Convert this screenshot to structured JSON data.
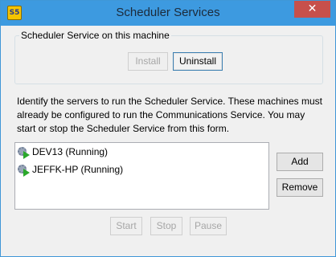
{
  "window": {
    "title": "Scheduler Services",
    "app_icon_text": "S5",
    "close_glyph": "✕"
  },
  "machine_group": {
    "label": "Scheduler Service on this machine",
    "install_label": "Install",
    "uninstall_label": "Uninstall"
  },
  "description": "Identify the servers to run the Scheduler Service. These machines must already be configured to run the Communications Service. You may start or stop the Scheduler Service from this form.",
  "servers": [
    {
      "label": "DEV13 (Running)",
      "icon": "running-service-icon"
    },
    {
      "label": "JEFFK-HP (Running)",
      "icon": "running-service-icon"
    }
  ],
  "actions": {
    "add_label": "Add",
    "remove_label": "Remove",
    "start_label": "Start",
    "stop_label": "Stop",
    "pause_label": "Pause"
  },
  "colors": {
    "titlebar": "#3d9ae0",
    "close": "#c7504b",
    "window_bg": "#f0f0f0"
  }
}
